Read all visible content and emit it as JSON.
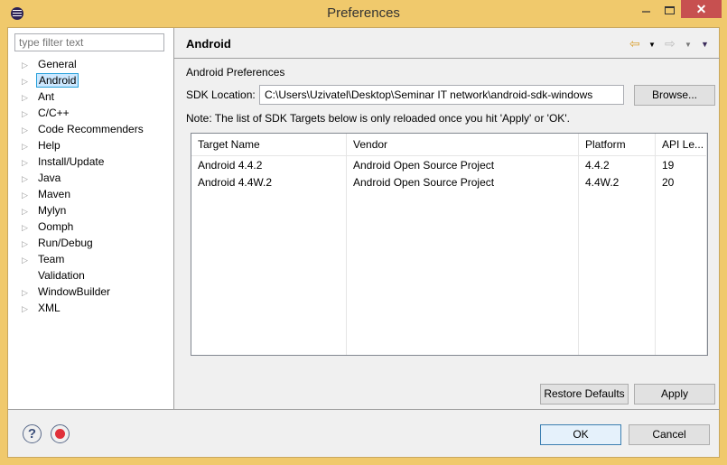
{
  "window": {
    "title": "Preferences",
    "close": "✕"
  },
  "sidebar": {
    "filter_placeholder": "type filter text",
    "items": [
      {
        "label": "General",
        "expandable": true
      },
      {
        "label": "Android",
        "expandable": true,
        "selected": true
      },
      {
        "label": "Ant",
        "expandable": true
      },
      {
        "label": "C/C++",
        "expandable": true
      },
      {
        "label": "Code Recommenders",
        "expandable": true
      },
      {
        "label": "Help",
        "expandable": true
      },
      {
        "label": "Install/Update",
        "expandable": true
      },
      {
        "label": "Java",
        "expandable": true
      },
      {
        "label": "Maven",
        "expandable": true
      },
      {
        "label": "Mylyn",
        "expandable": true
      },
      {
        "label": "Oomph",
        "expandable": true
      },
      {
        "label": "Run/Debug",
        "expandable": true
      },
      {
        "label": "Team",
        "expandable": true
      },
      {
        "label": "Validation",
        "expandable": false
      },
      {
        "label": "WindowBuilder",
        "expandable": true
      },
      {
        "label": "XML",
        "expandable": true
      }
    ]
  },
  "page": {
    "title": "Android",
    "section": "Android Preferences",
    "sdk_label": "SDK Location:",
    "sdk_value": "C:\\Users\\Uzivatel\\Desktop\\Seminar IT network\\android-sdk-windows",
    "browse": "Browse...",
    "note": "Note: The list of SDK Targets below is only reloaded once you hit 'Apply' or 'OK'.",
    "table": {
      "columns": [
        "Target Name",
        "Vendor",
        "Platform",
        "API Le..."
      ],
      "rows": [
        [
          "Android 4.4.2",
          "Android Open Source Project",
          "4.4.2",
          "19"
        ],
        [
          "Android 4.4W.2",
          "Android Open Source Project",
          "4.4W.2",
          "20"
        ]
      ]
    },
    "restore": "Restore Defaults",
    "apply": "Apply"
  },
  "footer": {
    "ok": "OK",
    "cancel": "Cancel",
    "help": "?"
  }
}
